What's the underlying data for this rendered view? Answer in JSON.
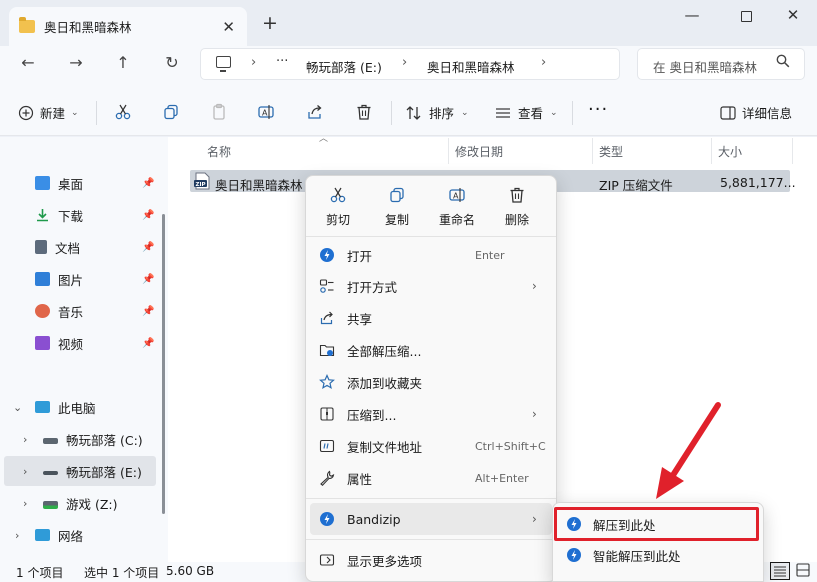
{
  "window": {
    "tab_title": "奥日和黑暗森林",
    "tab_close": "✕",
    "tab_add": "+",
    "min": "—",
    "close": "✕"
  },
  "nav": {
    "back": "←",
    "forward": "→",
    "up": "↑",
    "refresh": "↻"
  },
  "address": {
    "more": "···",
    "crumbs": [
      "畅玩部落 (E:)",
      "奥日和黑暗森林"
    ],
    "chevron": "›",
    "search_placeholder": "在 奥日和黑暗森林"
  },
  "toolbar": {
    "new_label": "新建",
    "sort_label": "排序",
    "view_label": "查看",
    "more_label": "···",
    "details_label": "详细信息",
    "caret": "⌄"
  },
  "sidebar": {
    "quick_items": [
      {
        "label": "桌面",
        "color": "#3a8ee6"
      },
      {
        "label": "下载",
        "color": "#1f9a4b"
      },
      {
        "label": "文档",
        "color": "#5d6b7c"
      },
      {
        "label": "图片",
        "color": "#2f7fd8"
      },
      {
        "label": "音乐",
        "color": "#e0664a"
      },
      {
        "label": "视频",
        "color": "#8a4fd1"
      }
    ],
    "pin": "📌",
    "this_pc": "此电脑",
    "drives": [
      "畅玩部落 (C:)",
      "畅玩部落 (E:)",
      "游戏 (Z:)"
    ],
    "network": "网络",
    "chev_open": "⌄",
    "chev_closed": "›"
  },
  "columns": {
    "name": "名称",
    "modified": "修改日期",
    "type": "类型",
    "size": "大小"
  },
  "file": {
    "name": "奥日和黑暗森林",
    "type": "ZIP 压缩文件",
    "size": "5,881,177..."
  },
  "status": {
    "count": "1 个项目",
    "selected": "选中 1 个项目",
    "size": "5.60 GB"
  },
  "context_menu": {
    "quick_actions": [
      "剪切",
      "复制",
      "重命名",
      "删除"
    ],
    "items": [
      {
        "label": "打开",
        "shortcut": "Enter"
      },
      {
        "label": "打开方式",
        "arrow": "›"
      },
      {
        "label": "共享"
      },
      {
        "label": "全部解压缩..."
      },
      {
        "label": "添加到收藏夹"
      },
      {
        "label": "压缩到...",
        "arrow": "›"
      },
      {
        "label": "复制文件地址",
        "shortcut": "Ctrl+Shift+C"
      },
      {
        "label": "属性",
        "shortcut": "Alt+Enter"
      }
    ],
    "bandizip": "Bandizip",
    "bandizip_arrow": "›",
    "show_more": "显示更多选项"
  },
  "submenu": {
    "items": [
      "解压到此处",
      "智能解压到此处"
    ]
  },
  "colors": {
    "accent": "#005fb8",
    "highlight_box": "#e0212b",
    "arrow": "#e0212b",
    "bandizip_blue": "#1f6fd1"
  }
}
